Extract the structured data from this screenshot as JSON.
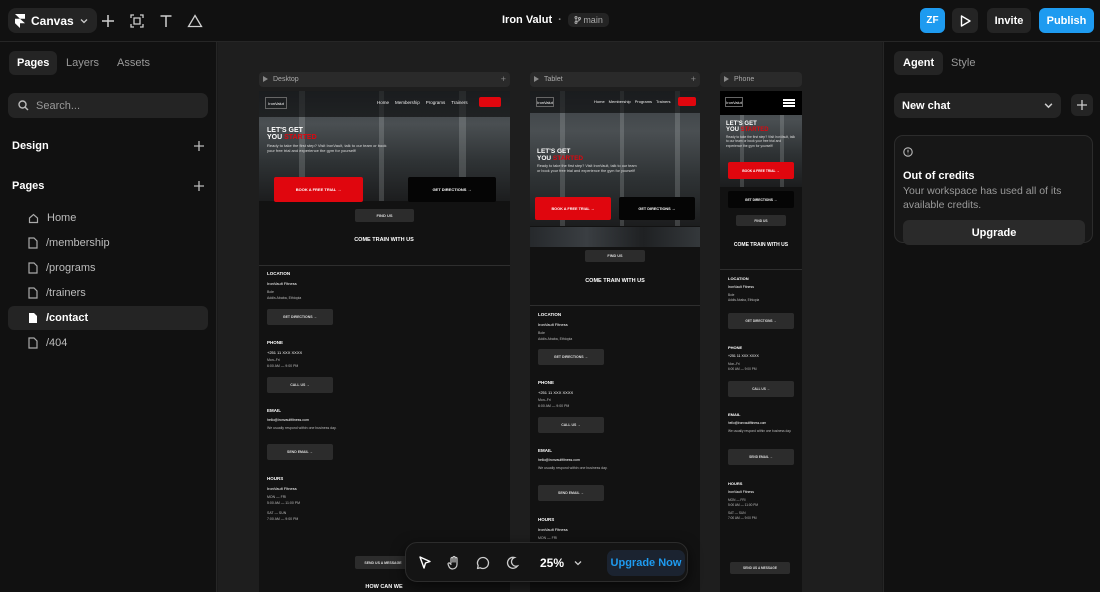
{
  "app": {
    "menu_label": "Canvas",
    "project_title": "Iron Valut",
    "branch": "main",
    "avatar_initials": "ZF",
    "invite_label": "Invite",
    "publish_label": "Publish",
    "accent": "#1e9bf0"
  },
  "left_panel": {
    "tabs": [
      "Pages",
      "Layers",
      "Assets"
    ],
    "search_placeholder": "Search...",
    "design_label": "Design",
    "pages_label": "Pages",
    "pages": [
      "Home",
      "/membership",
      "/programs",
      "/trainers",
      "/contact",
      "/404"
    ],
    "active_page": "/contact"
  },
  "right_panel": {
    "tabs": [
      "Agent",
      "Style"
    ],
    "chat_select": "New chat",
    "credits_title": "Out of credits",
    "credits_message": "Your workspace has used all of its available credits.",
    "upgrade_label": "Upgrade"
  },
  "canvas": {
    "frames": {
      "desktop": "Desktop",
      "tablet": "Tablet",
      "phone": "Phone"
    },
    "site": {
      "logo": "IronValut",
      "nav": [
        "Home",
        "Membership",
        "Programs",
        "Trainers"
      ],
      "hero_line1": "LET'S GET",
      "hero_line2a": "YOU",
      "hero_line2b": "STARTED",
      "hero_sub": "Ready to take the first step? Visit IronVault, talk to our team or book your free trial and experience the gym for yourself!",
      "btn_trial": "BOOK A FREE TRIAL →",
      "btn_directions": "GET DIRECTIONS →",
      "find_us": "FIND US",
      "come_train": "COME TRAIN WITH US",
      "location_label": "LOCATION",
      "location_name": "IronVault Fitness",
      "location_area": "Bole",
      "location_city": "Addis Ababa, Ethiopia",
      "get_directions_btn": "GET DIRECTIONS →",
      "phone_label": "PHONE",
      "phone_number": "+251 11 XXX XXXX",
      "phone_days": "Mon–Fri",
      "phone_hours": "6:00 AM — 9:00 PM",
      "call_btn": "CALL US →",
      "email_label": "EMAIL",
      "email_addr": "hello@ironvaultfitness.com",
      "email_note": "We usually respond within one business day.",
      "send_email_btn": "SEND EMAIL →",
      "hours_label": "HOURS",
      "hours_name": "IronVault Fitness",
      "hours_wk": "MON — FRI",
      "hours_wk_time": "5:00 AM — 11:00 PM",
      "hours_we": "SAT — SUN",
      "hours_we_time": "7:00 AM — 9:00 PM",
      "send_msg_btn": "SEND US A MESSAGE",
      "how_can": "HOW CAN WE"
    }
  },
  "toolbar": {
    "zoom": "25%",
    "upgrade_now": "Upgrade Now"
  }
}
